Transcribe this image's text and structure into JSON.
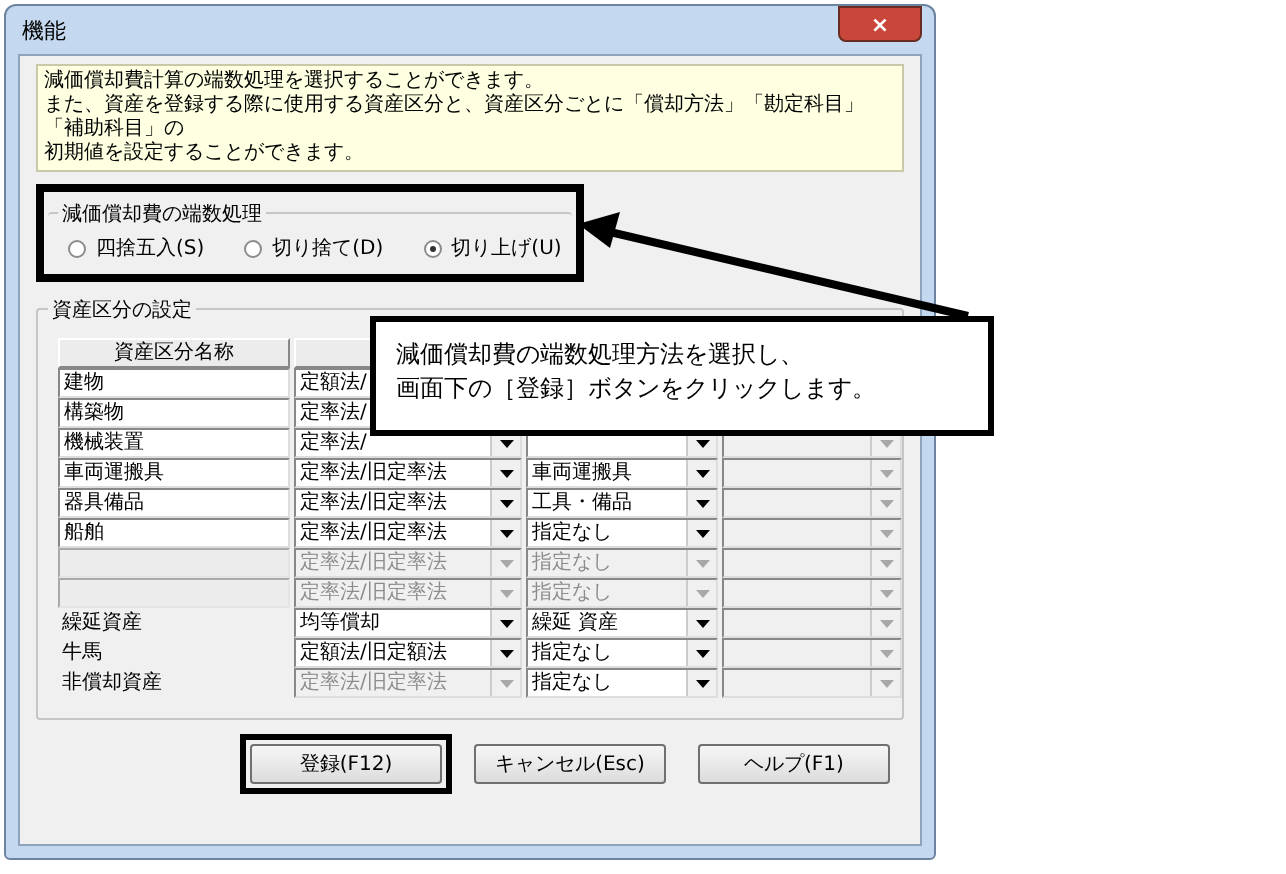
{
  "window": {
    "title": "機能",
    "close": "×"
  },
  "info": {
    "lines": [
      "減価償却費計算の端数処理を選択することができます。",
      "また、資産を登録する際に使用する資産区分と、資産区分ごとに「償却方法」「勘定科目」「補助科目」の",
      "初期値を設定することができます。"
    ]
  },
  "rounding": {
    "title": "減価償却費の端数処理",
    "highlighted": true,
    "options": [
      {
        "label": "四捨五入(S)",
        "selected": false
      },
      {
        "label": "切り捨て(D)",
        "selected": false
      },
      {
        "label": "切り上げ(U)",
        "selected": true
      }
    ]
  },
  "assets": {
    "title": "資産区分の設定",
    "columns": [
      "資産区分名称"
    ],
    "rows": [
      {
        "name": "建物",
        "kind": "field",
        "name_disabled": false,
        "method": {
          "value": "定額法/",
          "disabled": false
        }
      },
      {
        "name": "構築物",
        "kind": "field",
        "name_disabled": false,
        "method": {
          "value": "定率法/",
          "disabled": false
        }
      },
      {
        "name": "機械装置",
        "kind": "field",
        "name_disabled": false,
        "method": {
          "value": "定率法/",
          "disabled": false
        },
        "account": {
          "disabled": false
        },
        "sub": {
          "disabled": true
        }
      },
      {
        "name": "車両運搬具",
        "kind": "field",
        "name_disabled": false,
        "method": {
          "value": "定率法/旧定率法",
          "disabled": false
        },
        "account": {
          "value": "車両運搬具",
          "disabled": false
        },
        "sub": {
          "disabled": true
        }
      },
      {
        "name": "器具備品",
        "kind": "field",
        "name_disabled": false,
        "method": {
          "value": "定率法/旧定率法",
          "disabled": false
        },
        "account": {
          "value": "工具・備品",
          "disabled": false
        },
        "sub": {
          "disabled": true
        }
      },
      {
        "name": "船舶",
        "kind": "field",
        "name_disabled": false,
        "method": {
          "value": "定率法/旧定率法",
          "disabled": false
        },
        "account": {
          "value": "指定なし",
          "disabled": false
        },
        "sub": {
          "disabled": true
        }
      },
      {
        "kind": "field",
        "name_disabled": true,
        "method": {
          "value": "定率法/旧定率法",
          "disabled": true
        },
        "account": {
          "value": "指定なし",
          "disabled": true
        },
        "sub": {
          "disabled": true
        }
      },
      {
        "kind": "field",
        "name_disabled": true,
        "method": {
          "value": "定率法/旧定率法",
          "disabled": true
        },
        "account": {
          "value": "指定なし",
          "disabled": true
        },
        "sub": {
          "disabled": true
        }
      },
      {
        "name": "繰延資産",
        "kind": "label",
        "method": {
          "value": "均等償却",
          "disabled": false
        },
        "account": {
          "value": "繰延 資産",
          "disabled": false
        },
        "sub": {
          "disabled": true
        }
      },
      {
        "name": "牛馬",
        "kind": "label",
        "method": {
          "value": "定額法/旧定額法",
          "disabled": false
        },
        "account": {
          "value": "指定なし",
          "disabled": false
        },
        "sub": {
          "disabled": true
        }
      },
      {
        "name": "非償却資産",
        "kind": "label",
        "method": {
          "value": "定率法/旧定率法",
          "disabled": true
        },
        "account": {
          "value": "指定なし",
          "disabled": false
        },
        "sub": {
          "disabled": true
        }
      }
    ]
  },
  "buttons": [
    {
      "label": "登録(F12)",
      "highlighted": true
    },
    {
      "label": "キャンセル(Esc)",
      "highlighted": false
    },
    {
      "label": "ヘルプ(F1)",
      "highlighted": false
    }
  ],
  "callout": {
    "lines": [
      "減価償却費の端数処理方法を選択し、",
      "画面下の［登録］ボタンをクリックします。"
    ]
  }
}
